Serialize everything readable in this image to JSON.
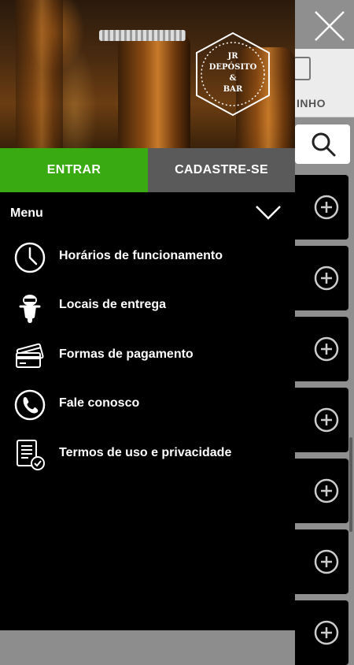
{
  "background": {
    "header_label": "INHO",
    "item_count": 7
  },
  "hero": {
    "logo_line1": "JR",
    "logo_line2": "DEPÓSITO",
    "logo_line3": "&",
    "logo_line4": "BAR"
  },
  "auth": {
    "login_label": "ENTRAR",
    "register_label": "CADASTRE-SE"
  },
  "menu": {
    "title": "Menu",
    "items": [
      {
        "label": "Horários de funcionamento",
        "icon": "clock-icon"
      },
      {
        "label": "Locais de entrega",
        "icon": "scooter-icon"
      },
      {
        "label": "Formas de pagamento",
        "icon": "credit-cards-icon"
      },
      {
        "label": "Fale conosco",
        "icon": "phone-icon"
      },
      {
        "label": "Termos de uso e privacidade",
        "icon": "document-check-icon"
      }
    ]
  },
  "colors": {
    "login_bg": "#3aaa12",
    "register_bg": "#5a5a5a",
    "drawer_bg": "#000000"
  }
}
